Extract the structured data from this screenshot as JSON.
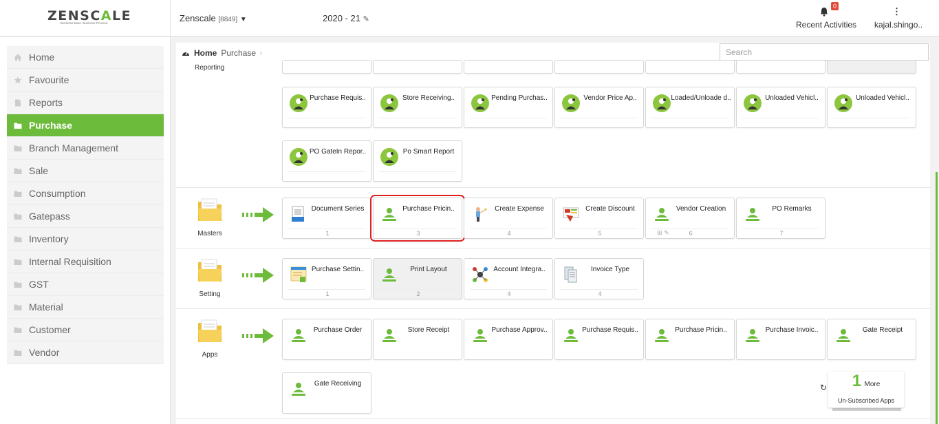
{
  "header": {
    "logo_pre": "ZENSC",
    "logo_accent": "A",
    "logo_post": "LE",
    "tagline": "Business Ease. Business Process.",
    "company": "Zenscale",
    "company_code": "[8849]",
    "year": "2020 - 21",
    "notification_count": "0",
    "recent_label": "Recent Activities",
    "user": "kajal.shingo.."
  },
  "sidebar": {
    "items": [
      {
        "label": "Home",
        "icon": "home-icon"
      },
      {
        "label": "Favourite",
        "icon": "star-icon"
      },
      {
        "label": "Reports",
        "icon": "file-icon"
      },
      {
        "label": "Purchase",
        "icon": "folder-icon",
        "active": true
      },
      {
        "label": "Branch Management",
        "icon": "folder-icon"
      },
      {
        "label": "Sale",
        "icon": "folder-icon"
      },
      {
        "label": "Consumption",
        "icon": "folder-icon"
      },
      {
        "label": "Gatepass",
        "icon": "folder-icon"
      },
      {
        "label": "Inventory",
        "icon": "folder-icon"
      },
      {
        "label": "Internal Requisition",
        "icon": "folder-icon"
      },
      {
        "label": "GST",
        "icon": "folder-icon"
      },
      {
        "label": "Material",
        "icon": "folder-icon"
      },
      {
        "label": "Customer",
        "icon": "folder-icon"
      },
      {
        "label": "Vendor",
        "icon": "folder-icon"
      }
    ]
  },
  "breadcrumb": {
    "home": "Home",
    "current": "Purchase"
  },
  "search": {
    "placeholder": "Search"
  },
  "reporting": {
    "label": "Reporting",
    "row1": [
      {
        "title": "Purchase Requis.."
      },
      {
        "title": "Store Receiving.."
      },
      {
        "title": "Pending Purchas.."
      },
      {
        "title": "Vendor Price Ap.."
      },
      {
        "title": "Loaded/Unloade d.."
      },
      {
        "title": "Unloaded Vehicl.."
      },
      {
        "title": "Unloaded Vehicl.."
      }
    ],
    "row2": [
      {
        "title": "PO GateIn Repor.."
      },
      {
        "title": "Po Smart Report"
      }
    ]
  },
  "masters": {
    "label": "Masters",
    "tiles": [
      {
        "title": "Document Series",
        "num": "1",
        "icon": "document-series-icon"
      },
      {
        "title": "Purchase Pricin..",
        "num": "3",
        "icon": "user-green-icon"
      },
      {
        "title": "Create Expense",
        "num": "4",
        "icon": "presenter-icon"
      },
      {
        "title": "Create Discount",
        "num": "5",
        "icon": "discount-icon"
      },
      {
        "title": "Vendor Creation",
        "num": "6",
        "icon": "user-green-icon"
      },
      {
        "title": "PO Remarks",
        "num": "7",
        "icon": "user-green-icon"
      }
    ]
  },
  "setting": {
    "label": "Setting",
    "tiles": [
      {
        "title": "Purchase Settin..",
        "num": "1",
        "icon": "settings-form-icon"
      },
      {
        "title": "Print Layout",
        "num": "2",
        "icon": "user-green-icon"
      },
      {
        "title": "Account Integra..",
        "num": "4",
        "icon": "integration-icon"
      },
      {
        "title": "Invoice Type",
        "num": "4",
        "icon": "invoice-icon"
      }
    ]
  },
  "apps": {
    "label": "Apps",
    "row1": [
      {
        "title": "Purchase Order"
      },
      {
        "title": "Store Receipt"
      },
      {
        "title": "Purchase Approv.."
      },
      {
        "title": "Purchase Requis.."
      },
      {
        "title": "Purchase Pricin.."
      },
      {
        "title": "Purchase Invoic.."
      },
      {
        "title": "Gate Receipt"
      }
    ],
    "row2": [
      {
        "title": "Gate Receiving"
      }
    ]
  },
  "more_apps": {
    "count": "1",
    "more": "More",
    "sub": "Un-Subscribed Apps"
  },
  "colors": {
    "accent": "#6dbb3b",
    "highlight": "#e02020"
  }
}
